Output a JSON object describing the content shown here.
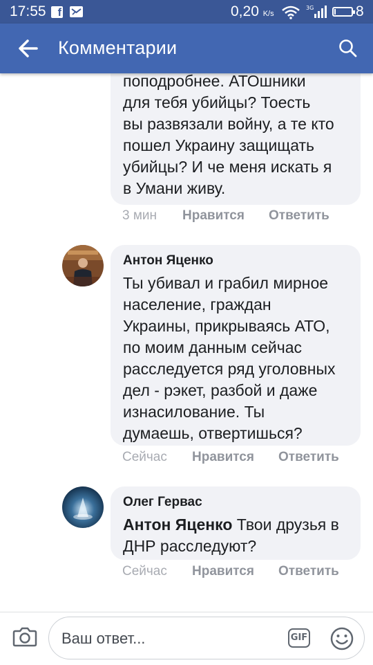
{
  "status_bar": {
    "time": "17:55",
    "network_speed": "0,20",
    "network_unit": "K/s",
    "signal_label": "3G",
    "battery_level": 0.08,
    "battery_text": "8"
  },
  "app_bar": {
    "title": "Комментарии",
    "back_icon": "arrow-left-icon",
    "search_icon": "search-icon"
  },
  "comments": [
    {
      "author": "",
      "lines": [
        "поподробнее. АТОшники",
        "для тебя убийцы?  Тоесть",
        "вы развязали войну, а те кто",
        "пошел Украину защищать",
        "убийцы?  И че меня искать я",
        "в Умани живу."
      ],
      "time": "3 мин",
      "like_label": "Нравится",
      "reply_label": "Ответить"
    },
    {
      "author": "Антон Яценко",
      "lines": [
        "Ты убивал и грабил мирное",
        "население, граждан",
        "Украины, прикрываясь АТО,",
        "по моим данным сейчас",
        "расследуется ряд уголовных",
        "дел - рэкет, разбой и даже",
        "изнасилование. Ты",
        "думаешь, отвертишься?"
      ],
      "time": "Сейчас",
      "like_label": "Нравится",
      "reply_label": "Ответить"
    },
    {
      "author": "Олег Гервас",
      "mention": "Антон Яценко",
      "line1_rest": " Твои друзья в",
      "line2": "ДНР расследуют?",
      "time": "Сейчас",
      "like_label": "Нравится",
      "reply_label": "Ответить"
    }
  ],
  "composer": {
    "placeholder": "Ваш ответ...",
    "gif_label": "GIF",
    "camera_icon": "camera-icon",
    "emoji_icon": "smiley-icon"
  },
  "colors": {
    "status_bar": "#3a5796",
    "app_bar": "#4267b2",
    "bubble": "#f1f2f6",
    "meta_text": "#90949c"
  }
}
